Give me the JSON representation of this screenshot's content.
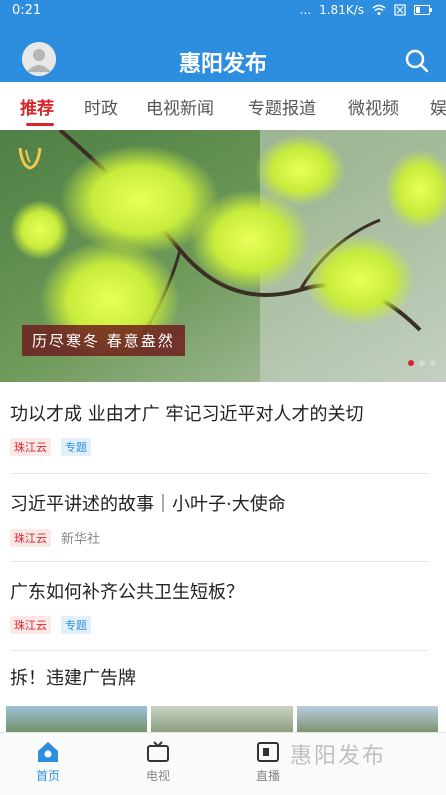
{
  "statusbar": {
    "time": "0:21",
    "dots": "...",
    "speed": "1.81K/s"
  },
  "header": {
    "title": "惠阳发布"
  },
  "tabs": [
    {
      "label": "推荐"
    },
    {
      "label": "时政"
    },
    {
      "label": "电视新闻"
    },
    {
      "label": "专题报道"
    },
    {
      "label": "微视频"
    },
    {
      "label": "娱"
    }
  ],
  "banner": {
    "caption": "历尽寒冬 春意盎然"
  },
  "news": [
    {
      "title": "功以才成 业由才广 牢记习近平对人才的关切",
      "tags": [
        "珠江云",
        "专题"
      ]
    },
    {
      "title": "习近平讲述的故事｜小叶子·大使命",
      "tags": [
        "珠江云"
      ],
      "source": "新华社"
    },
    {
      "title": "广东如何补齐公共卫生短板？",
      "tags": [
        "珠江云",
        "专题"
      ]
    },
    {
      "title": "拆！违建广告牌"
    }
  ],
  "bottomnav": [
    {
      "label": "首页"
    },
    {
      "label": "电视"
    },
    {
      "label": "直播"
    }
  ],
  "watermark": "惠阳发布",
  "colors": {
    "brand": "#2d8ee0",
    "accent": "#d7262b"
  }
}
